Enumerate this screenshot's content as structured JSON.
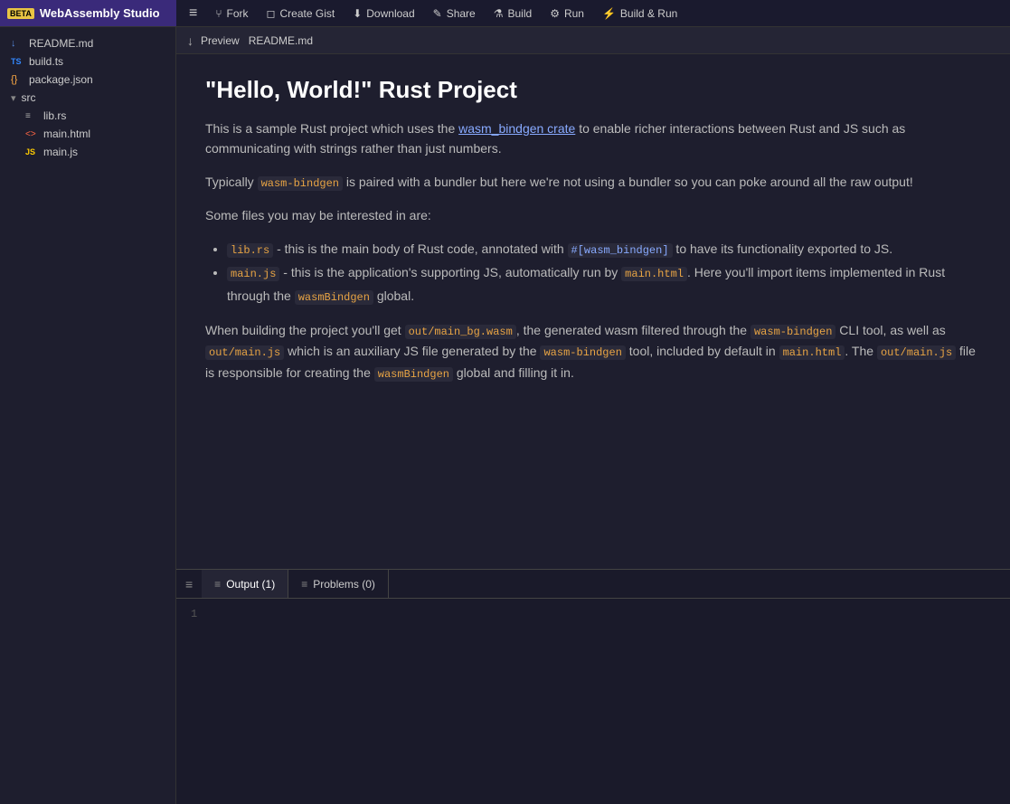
{
  "app": {
    "beta_label": "BETA",
    "title": "WebAssembly Studio"
  },
  "toolbar": {
    "hamburger": "≡",
    "fork_label": "Fork",
    "create_gist_label": "Create Gist",
    "download_label": "Download",
    "share_label": "Share",
    "build_label": "Build",
    "run_label": "Run",
    "build_run_label": "Build & Run"
  },
  "sidebar": {
    "files": [
      {
        "name": "README.md",
        "icon": "↓",
        "icon_class": "icon-md",
        "indent": false
      },
      {
        "name": "build.ts",
        "icon": "TS",
        "icon_class": "icon-ts",
        "indent": false
      },
      {
        "name": "package.json",
        "icon": "{}",
        "icon_class": "icon-json",
        "indent": false
      },
      {
        "name": "src",
        "icon": "▾",
        "icon_class": "folder-icon",
        "indent": false,
        "is_folder": true
      },
      {
        "name": "lib.rs",
        "icon": "≡",
        "icon_class": "icon-rs",
        "indent": true
      },
      {
        "name": "main.html",
        "icon": "<>",
        "icon_class": "icon-html",
        "indent": true
      },
      {
        "name": "main.js",
        "icon": "JS",
        "icon_class": "icon-js",
        "indent": true
      }
    ]
  },
  "preview": {
    "icon": "↓",
    "label": "Preview",
    "filename": "README.md"
  },
  "readme": {
    "title": "\"Hello, World!\" Rust Project",
    "para1_before": "This is a sample Rust project which uses the ",
    "para1_link": "wasm_bindgen crate",
    "para1_after": " to enable richer interactions between Rust and JS such as communicating with strings rather than just numbers.",
    "para2_before": "Typically ",
    "para2_code": "wasm-bindgen",
    "para2_after": " is paired with a bundler but here we're not using a bundler so you can poke around all the raw output!",
    "para3": "Some files you may be interested in are:",
    "bullet1_code1": "lib.rs",
    "bullet1_text": " - this is the main body of Rust code, annotated with ",
    "bullet1_code2": "#[wasm_bindgen]",
    "bullet1_text2": " to have its functionality exported to JS.",
    "bullet2_code1": "main.js",
    "bullet2_text": " - this is the application's supporting JS, automatically run by ",
    "bullet2_code2": "main.html",
    "bullet2_text2": ". Here you'll import items implemented in Rust through the ",
    "bullet2_code3": "wasmBindgen",
    "bullet2_text3": " global.",
    "para4_before": "When building the project you'll get ",
    "para4_code1": "out/main_bg.wasm",
    "para4_text1": ", the generated wasm filtered through the ",
    "para4_code2": "wasm-bindgen",
    "para4_text2": " CLI tool, as well as ",
    "para4_code3": "out/main.js",
    "para4_text3": " which is an auxiliary JS file generated by the ",
    "para4_code4": "wasm-bindgen",
    "para4_text4": " tool, included by default in ",
    "para4_code5": "main.html",
    "para4_text5": ". The ",
    "para4_code6": "out/main.js",
    "para4_text6": " file is responsible for creating the ",
    "para4_code7": "wasmBindgen",
    "para4_text7": " global and filling it in."
  },
  "bottom_panel": {
    "output_tab": "Output (1)",
    "problems_tab": "Problems (0)",
    "line_number": "1"
  }
}
